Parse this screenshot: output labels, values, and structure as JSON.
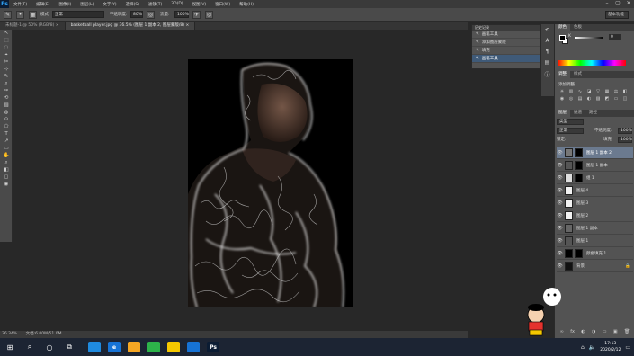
{
  "app": {
    "logo": "Ps"
  },
  "menu": [
    "文件(F)",
    "编辑(E)",
    "图像(I)",
    "图层(L)",
    "文字(Y)",
    "选择(S)",
    "滤镜(T)",
    "3D(D)",
    "视图(V)",
    "窗口(W)",
    "帮助(H)"
  ],
  "window_controls": [
    "–",
    "▢",
    "✕"
  ],
  "options_bar": {
    "mode_label": "模式:",
    "mode_value": "正常",
    "opacity_label": "不透明度:",
    "opacity_value": "80%",
    "flow_label": "流量:",
    "flow_value": "100%",
    "workspace": "基本功能"
  },
  "tabs": [
    {
      "label": "未标题-1 @ 50% (RGB/8) ×",
      "active": false
    },
    {
      "label": "basketball player.jpg @ 36.5% (图层 1 副本 2, 图层蒙版/8) ×",
      "active": true
    }
  ],
  "status_bar": {
    "zoom": "36.34%",
    "doc": "文档:6.00M/51.0M"
  },
  "history": {
    "title": "历史记录",
    "items": [
      {
        "label": "画笔工具",
        "active": false
      },
      {
        "label": "添加图层蒙版",
        "active": false
      },
      {
        "label": "填充",
        "active": false
      },
      {
        "label": "画笔工具",
        "active": true
      }
    ]
  },
  "color_panel": {
    "tabs": [
      "颜色",
      "色板"
    ],
    "k_label": "K",
    "k_value": "0",
    "fg": "#000000",
    "bg": "#ffffff"
  },
  "adjust_panel": {
    "tabs": [
      "调整",
      "样式"
    ],
    "title": "添加调整"
  },
  "layers_panel": {
    "tabs": [
      "图层",
      "通道",
      "路径"
    ],
    "kind_label": "类型",
    "blend": "正常",
    "opacity_label": "不透明度:",
    "opacity": "100%",
    "lock_label": "锁定:",
    "fill_label": "填充:",
    "fill": "100%",
    "layers": [
      {
        "name": "图层 1 副本 2",
        "thumb": "#777777",
        "mask": true,
        "active": true
      },
      {
        "name": "图层 1 副本",
        "thumb": "#555555",
        "mask": true,
        "active": false
      },
      {
        "name": "组 1",
        "thumb": "#dddddd",
        "mask": true,
        "active": false,
        "group": true
      },
      {
        "name": "图层 4",
        "thumb": "#f2f2f2",
        "mask": false,
        "active": false
      },
      {
        "name": "图层 3",
        "thumb": "#f2f2f2",
        "mask": false,
        "active": false
      },
      {
        "name": "图层 2",
        "thumb": "#f2f2f2",
        "mask": false,
        "active": false
      },
      {
        "name": "图层 1 副本",
        "thumb": "#666666",
        "mask": false,
        "active": false
      },
      {
        "name": "图层 1",
        "thumb": "#555555",
        "mask": false,
        "active": false
      },
      {
        "name": "颜色填充 1",
        "thumb": "#000000",
        "mask": true,
        "active": false
      },
      {
        "name": "背景",
        "thumb": "#111111",
        "mask": false,
        "active": false,
        "locked": true
      }
    ],
    "bottom_icons": [
      "∞",
      "fx",
      "◐",
      "◑",
      "▭",
      "▣",
      "🗑"
    ]
  },
  "tools": [
    "↖",
    "⬚",
    "◌",
    "⌖",
    "✂",
    "⊹",
    "✎",
    "⌕",
    "✑",
    "⟲",
    "▨",
    "◍",
    "⊙",
    "⬠",
    "T",
    "↗",
    "▭",
    "✋",
    "⌕",
    "◧",
    "◻",
    "◉"
  ],
  "taskbar": {
    "apps": [
      {
        "label": "",
        "color": "#1f8ae0"
      },
      {
        "label": "e",
        "color": "#1673d6"
      },
      {
        "label": "",
        "color": "#f5a623"
      },
      {
        "label": "",
        "color": "#2db34a"
      },
      {
        "label": "",
        "color": "#f5c800"
      },
      {
        "label": "",
        "color": "#1673d6"
      },
      {
        "label": "Ps",
        "color": "#0b1c33"
      }
    ],
    "time": "17:13",
    "date": "2020/2/12"
  }
}
